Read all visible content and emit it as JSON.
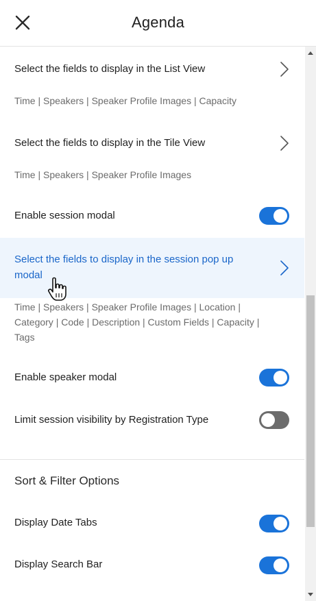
{
  "header": {
    "title": "Agenda",
    "close_icon": "close-icon"
  },
  "settings": {
    "list_view": {
      "label": "Select the fields to display in the List View",
      "fields": "Time | Speakers | Speaker Profile Images | Capacity"
    },
    "tile_view": {
      "label": "Select the fields to display in the Tile View",
      "fields": "Time | Speakers | Speaker Profile Images"
    },
    "session_modal": {
      "label": "Enable session modal",
      "enabled": true
    },
    "session_popup": {
      "label": "Select the fields to display in the session pop up modal",
      "fields": "Time | Speakers | Speaker Profile Images | Location | Category | Code | Description | Custom Fields | Capacity | Tags"
    },
    "speaker_modal": {
      "label": "Enable speaker modal",
      "enabled": true
    },
    "limit_visibility": {
      "label": "Limit session visibility by Registration Type",
      "enabled": false
    }
  },
  "sort_filter": {
    "title": "Sort & Filter Options",
    "date_tabs": {
      "label": "Display Date Tabs",
      "enabled": true
    },
    "search_bar": {
      "label": "Display Search Bar",
      "enabled": true
    }
  },
  "colors": {
    "accent": "#1a73d9",
    "highlight_bg": "#eef5fd",
    "link_text": "#1a66c9",
    "toggle_off": "#6c6c6c"
  }
}
